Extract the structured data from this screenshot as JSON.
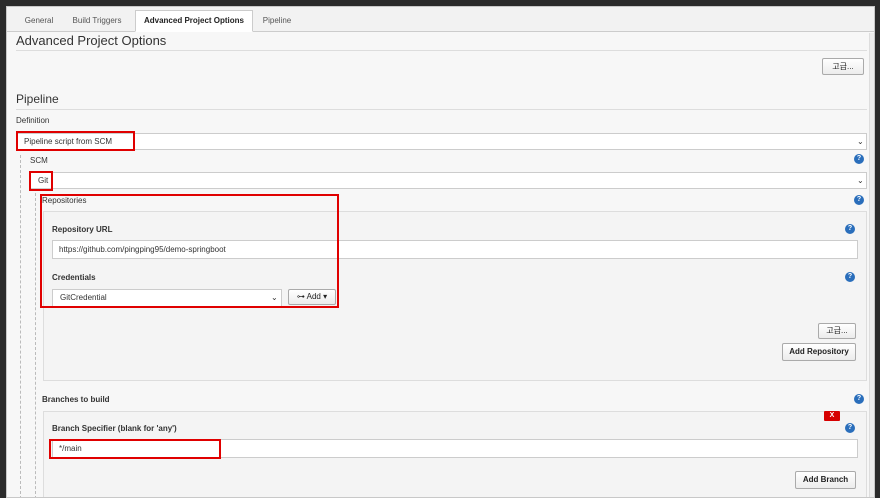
{
  "tabs": [
    {
      "label": "General",
      "active": false
    },
    {
      "label": "Build Triggers",
      "active": false
    },
    {
      "label": "Advanced Project Options",
      "active": true
    },
    {
      "label": "Pipeline",
      "active": false
    }
  ],
  "advanced": {
    "title": "Advanced Project Options",
    "advanced_button": "고급..."
  },
  "pipeline": {
    "title": "Pipeline",
    "definition_label": "Definition",
    "definition_value": "Pipeline script from SCM",
    "scm_label": "SCM",
    "scm_value": "Git",
    "repositories_label": "Repositories",
    "repository_url_label": "Repository URL",
    "repository_url_value": "https://github.com/pingping95/demo-springboot",
    "credentials_label": "Credentials",
    "credentials_value": "GitCredential",
    "add_button": "Add",
    "repo_advanced_button": "고급...",
    "add_repository_button": "Add Repository",
    "branches_label": "Branches to build",
    "branch_specifier_label": "Branch Specifier (blank for 'any')",
    "branch_specifier_value": "*/main",
    "remove_label": "X",
    "add_branch_button": "Add Branch"
  },
  "colors": {
    "highlight": "#e00000",
    "help": "#2a6ebb",
    "remove": "#d60000"
  }
}
